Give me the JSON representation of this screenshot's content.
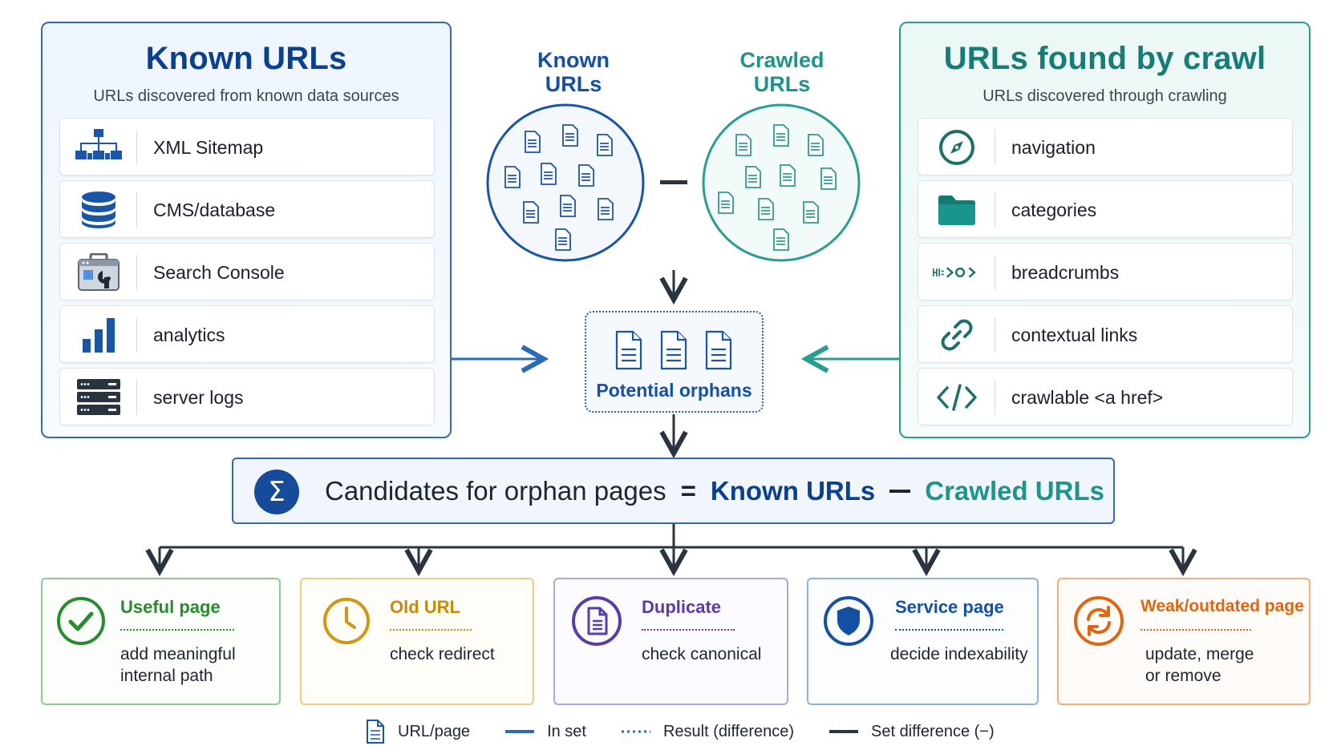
{
  "known_panel": {
    "title": "Known URLs",
    "subtitle": "URLs discovered from known data sources",
    "accent": "#2f6ab3",
    "items": [
      {
        "label": "XML Sitemap",
        "icon": "sitemap-icon"
      },
      {
        "label": "CMS/database",
        "icon": "database-icon"
      },
      {
        "label": "Search Console",
        "icon": "search-console-icon"
      },
      {
        "label": "analytics",
        "icon": "bar-chart-icon"
      },
      {
        "label": "server logs",
        "icon": "server-icon"
      }
    ]
  },
  "crawl_panel": {
    "title": "URLs found by crawl",
    "subtitle": "URLs discovered through crawling",
    "accent": "#2a9d93",
    "items": [
      {
        "label": "navigation",
        "icon": "compass-icon"
      },
      {
        "label": "categories",
        "icon": "folder-icon"
      },
      {
        "label": "breadcrumbs",
        "icon": "breadcrumb-icon"
      },
      {
        "label": "contextual links",
        "icon": "link-icon"
      },
      {
        "label": "crawlable <a href>",
        "icon": "code-icon"
      }
    ]
  },
  "sets": {
    "known_label": "Known URLs",
    "crawled_label": "Crawled URLs"
  },
  "result": {
    "label": "Potential orphans"
  },
  "formula": {
    "lhs": "Candidates for orphan pages",
    "equals": "=",
    "known": "Known URLs",
    "crawled": "Crawled URLs"
  },
  "outcomes": [
    {
      "title": "Useful page",
      "body_line1": "add meaningful",
      "body_line2": "internal path",
      "color": "#2a8a2e",
      "icon": "check-circle-icon"
    },
    {
      "title": "Old URL",
      "body_line1": "check redirect",
      "body_line2": "",
      "color": "#c98a07",
      "icon": "clock-icon"
    },
    {
      "title": "Duplicate",
      "body_line1": "check canonical",
      "body_line2": "",
      "color": "#5a3ba8",
      "icon": "document-icon"
    },
    {
      "title": "Service page",
      "body_line1": "decide indexability",
      "body_line2": "",
      "color": "#1450a3",
      "icon": "shield-icon"
    },
    {
      "title": "Weak/outdated page",
      "body_line1": "update, merge",
      "body_line2": "or remove",
      "color": "#e06510",
      "icon": "refresh-icon"
    }
  ],
  "legend": {
    "page": "URL/page",
    "in_set": "In set",
    "result": "Result (difference)",
    "difference": "Set difference (−)"
  }
}
